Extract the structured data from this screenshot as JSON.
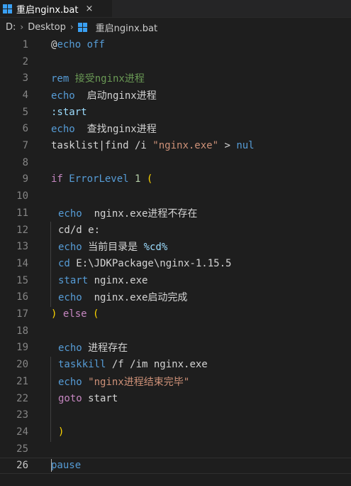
{
  "tab": {
    "title": "重启nginx.bat",
    "close_glyph": "×",
    "icon": "windows-icon"
  },
  "breadcrumb": {
    "drive": "D:",
    "folder": "Desktop",
    "file": "重启nginx.bat",
    "separator": "›"
  },
  "colors": {
    "keyword": "#569cd6",
    "string": "#ce9178",
    "text": "#d4d4d4",
    "comment": "#6a9955",
    "number": "#b5cea8",
    "variable": "#9cdcfe",
    "control": "#c586c0",
    "bracket": "#ffd700"
  },
  "current_line": 26,
  "lines": [
    {
      "n": "1",
      "tokens": [
        {
          "t": "@",
          "c": "text"
        },
        {
          "t": "echo off",
          "c": "keyword"
        }
      ]
    },
    {
      "n": "2",
      "tokens": []
    },
    {
      "n": "3",
      "tokens": [
        {
          "t": "rem ",
          "c": "keyword"
        },
        {
          "t": "接受nginx进程",
          "c": "comment"
        }
      ]
    },
    {
      "n": "4",
      "tokens": [
        {
          "t": "echo",
          "c": "keyword"
        },
        {
          "t": "  启动nginx进程",
          "c": "text"
        }
      ]
    },
    {
      "n": "5",
      "tokens": [
        {
          "t": ":start",
          "c": "variable"
        }
      ]
    },
    {
      "n": "6",
      "tokens": [
        {
          "t": "echo",
          "c": "keyword"
        },
        {
          "t": "  查找nginx进程",
          "c": "text"
        }
      ]
    },
    {
      "n": "7",
      "tokens": [
        {
          "t": "tasklist|find /i ",
          "c": "text"
        },
        {
          "t": "\"nginx.exe\"",
          "c": "string"
        },
        {
          "t": " > ",
          "c": "text"
        },
        {
          "t": "nul",
          "c": "keyword"
        }
      ]
    },
    {
      "n": "8",
      "tokens": []
    },
    {
      "n": "9",
      "tokens": [
        {
          "t": "if ",
          "c": "control"
        },
        {
          "t": "ErrorLevel",
          "c": "keyword"
        },
        {
          "t": " ",
          "c": "text"
        },
        {
          "t": "1",
          "c": "number"
        },
        {
          "t": " ",
          "c": "text"
        },
        {
          "t": "(",
          "c": "bracket"
        }
      ]
    },
    {
      "n": "10",
      "tokens": []
    },
    {
      "n": "11",
      "indent": 1,
      "tokens": [
        {
          "t": "echo",
          "c": "keyword"
        },
        {
          "t": "  nginx.exe进程不存在",
          "c": "text"
        }
      ]
    },
    {
      "n": "12",
      "indent": 1,
      "tokens": [
        {
          "t": "cd/d e:",
          "c": "text"
        }
      ]
    },
    {
      "n": "13",
      "indent": 1,
      "tokens": [
        {
          "t": "echo",
          "c": "keyword"
        },
        {
          "t": " 当前目录是 ",
          "c": "text"
        },
        {
          "t": "%cd%",
          "c": "variable"
        }
      ]
    },
    {
      "n": "14",
      "indent": 1,
      "tokens": [
        {
          "t": "cd",
          "c": "keyword"
        },
        {
          "t": " E:\\JDKPackage\\nginx-1.15.5",
          "c": "text"
        }
      ]
    },
    {
      "n": "15",
      "indent": 1,
      "tokens": [
        {
          "t": "start",
          "c": "keyword"
        },
        {
          "t": " nginx.exe",
          "c": "text"
        }
      ]
    },
    {
      "n": "16",
      "indent": 1,
      "tokens": [
        {
          "t": "echo",
          "c": "keyword"
        },
        {
          "t": "  nginx.exe启动完成",
          "c": "text"
        }
      ]
    },
    {
      "n": "17",
      "tokens": [
        {
          "t": ")",
          "c": "bracket"
        },
        {
          "t": " else ",
          "c": "control"
        },
        {
          "t": "(",
          "c": "bracket"
        }
      ]
    },
    {
      "n": "18",
      "tokens": []
    },
    {
      "n": "19",
      "indent": 1,
      "tokens": [
        {
          "t": "echo",
          "c": "keyword"
        },
        {
          "t": " 进程存在",
          "c": "text"
        }
      ]
    },
    {
      "n": "20",
      "indent": 1,
      "tokens": [
        {
          "t": "taskkill",
          "c": "keyword"
        },
        {
          "t": " /f /im nginx.exe",
          "c": "text"
        }
      ]
    },
    {
      "n": "21",
      "indent": 1,
      "tokens": [
        {
          "t": "echo",
          "c": "keyword"
        },
        {
          "t": " ",
          "c": "text"
        },
        {
          "t": "\"nginx进程结束完毕\"",
          "c": "string"
        }
      ]
    },
    {
      "n": "22",
      "indent": 1,
      "tokens": [
        {
          "t": "goto",
          "c": "control"
        },
        {
          "t": " start",
          "c": "text"
        }
      ]
    },
    {
      "n": "23",
      "tokens": []
    },
    {
      "n": "24",
      "indent": 1,
      "tokens": [
        {
          "t": ")",
          "c": "bracket"
        }
      ]
    },
    {
      "n": "25",
      "tokens": []
    },
    {
      "n": "26",
      "tokens": [
        {
          "t": "pause",
          "c": "keyword"
        }
      ]
    }
  ]
}
